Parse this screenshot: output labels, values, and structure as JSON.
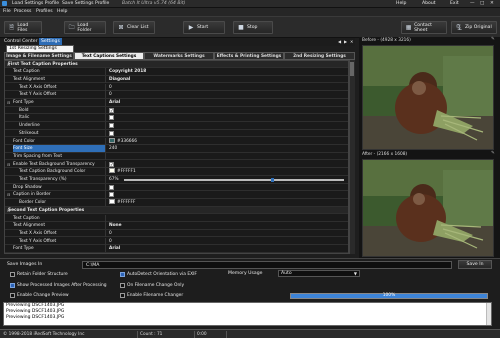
{
  "window": {
    "menu_left": [
      "Load Settings Profile",
      "Save Settings Profile"
    ],
    "title": "Batch It Ultra v5.74 (64 Bit)",
    "menu_right": [
      "Help",
      "About",
      "Exit"
    ],
    "window_buttons": [
      "—",
      "□",
      "✕"
    ]
  },
  "menubar": [
    "File",
    "Process",
    "Profiles",
    "Help"
  ],
  "toolbar": {
    "load_files": "Load Files",
    "load_folder": "Load Folder",
    "clear_list": "Clear List",
    "start": "Start",
    "stop": "Stop",
    "contact_sheet": "Contact Sheet",
    "zip_original": "Zip Original"
  },
  "control_center": {
    "label": "Control Center",
    "settings_btn": "Settings",
    "dropdown_value": "1st Resizing Settings",
    "tabs": [
      "Image & Filename Settings",
      "Text Captions Settings",
      "Watermarks Settings",
      "Effects & Printing Settings",
      "2nd Resizing Settings"
    ],
    "active_tab": 1
  },
  "grid_rows": [
    {
      "type": "header",
      "label": "First Text Caption Properties"
    },
    {
      "type": "text",
      "label": "Text Caption",
      "value": "Copyright 2018",
      "bold": true
    },
    {
      "type": "text",
      "label": "Text Alignment",
      "value": "Diagonal",
      "bold": true
    },
    {
      "type": "text",
      "label": "Text X Axis Offset",
      "value": "0",
      "indent": true
    },
    {
      "type": "text",
      "label": "Text Y Axis Offset",
      "value": "0",
      "indent": true
    },
    {
      "type": "text",
      "label": "Font Type",
      "value": "Arial",
      "bold": true,
      "expander": true
    },
    {
      "type": "check",
      "label": "Bold",
      "checked": true,
      "indent": true
    },
    {
      "type": "check",
      "label": "Italic",
      "checked": false,
      "indent": true
    },
    {
      "type": "check",
      "label": "Underline",
      "checked": false,
      "indent": true
    },
    {
      "type": "check",
      "label": "Strikeout",
      "checked": false,
      "indent": true
    },
    {
      "type": "color",
      "label": "Font Color",
      "value": "#336666",
      "color": "#336666"
    },
    {
      "type": "text",
      "label": "Font Size",
      "value": "240",
      "selected": true
    },
    {
      "type": "text",
      "label": "Trim Spacing from Text",
      "value": ""
    },
    {
      "type": "check",
      "label": "Enable Text Background Transparency",
      "checked": true,
      "expander": true
    },
    {
      "type": "color",
      "label": "Text Caption Background Color",
      "value": "#FFFFF1",
      "color": "#FFFFF1",
      "indent": true
    },
    {
      "type": "slider",
      "label": "Text Transparency (%)",
      "value": "67%",
      "fraction": 0.67,
      "indent": true
    },
    {
      "type": "check",
      "label": "Drop Shadow",
      "checked": false
    },
    {
      "type": "check",
      "label": "Caption in Border",
      "checked": false,
      "expander": true
    },
    {
      "type": "color",
      "label": "Border Color",
      "value": "#FFFFFF",
      "color": "#FFFFFF",
      "indent": true
    },
    {
      "type": "header",
      "label": "Second Text Caption Properties"
    },
    {
      "type": "text",
      "label": "Text Caption",
      "value": ""
    },
    {
      "type": "text",
      "label": "Text Alignment",
      "value": "None",
      "bold": true
    },
    {
      "type": "text",
      "label": "Text X Axis Offset",
      "value": "0",
      "indent": true
    },
    {
      "type": "text",
      "label": "Text Y Axis Offset",
      "value": "0",
      "indent": true
    },
    {
      "type": "text",
      "label": "Font Type",
      "value": "Arial",
      "bold": true
    }
  ],
  "preview": {
    "before_label": "Before - (4928 x 3216)",
    "after_label": "After - (2166 x 1608)",
    "pin": "✎"
  },
  "bottom": {
    "save_images_in": "Save Images In",
    "path": "C:\\MA",
    "save_in_btn": "Save In",
    "options": [
      {
        "label": "Retain Folder Structure",
        "checked": false
      },
      {
        "label": "Show Processed Images After Processing",
        "checked": true
      },
      {
        "label": "Enable Change Preview",
        "checked": false
      },
      {
        "label": "AutoDetect Orientation via EXIF",
        "checked": true
      },
      {
        "label": "On Filename Change Only",
        "checked": false
      },
      {
        "label": "Enable Filename Changer",
        "checked": false
      }
    ],
    "memory_label": "Memory Usage",
    "memory_value": "Auto",
    "progress_text": "100%",
    "progress_fraction": 1.0
  },
  "log_lines": [
    "Previewing DSCF1403.JPG",
    "Previewing DSCF1403.JPG",
    "Previewing DSCF1403.JPG"
  ],
  "status": {
    "copyright": "© 1998-2018 iRedSoft Technology Inc",
    "count": "Count : 71",
    "time": "0:00"
  }
}
